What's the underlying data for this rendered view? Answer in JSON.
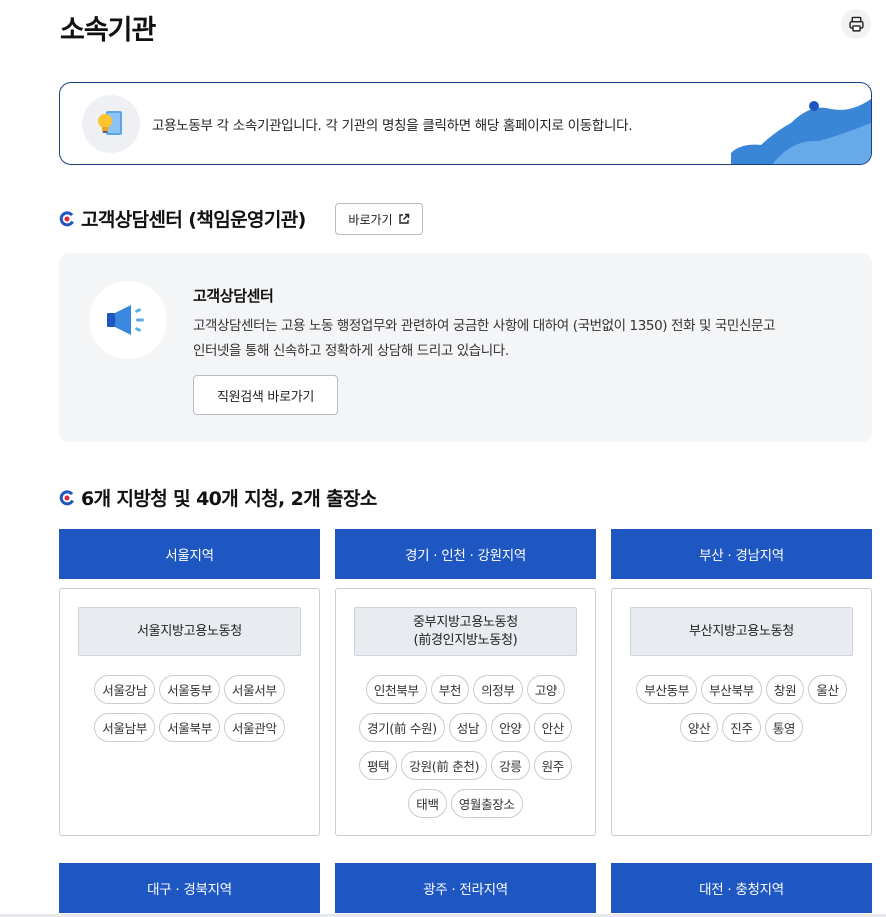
{
  "page": {
    "title": "소속기관"
  },
  "info": {
    "text": "고용노동부 각 소속기관입니다. 각 기관의 명칭을 클릭하면 해당 홈페이지로 이동합니다."
  },
  "callcenter": {
    "section_title": "고객상담센터 (책임운영기관)",
    "go_label": "바로가기",
    "name": "고객상담센터",
    "desc_line1": "고객상담센터는 고용 노동 행정업무와 관련하여 궁금한 사항에 대하여 (국번없이 1350) 전화 및 국민신문고",
    "desc_line2": "인터넷을 통해 신속하고 정확하게 상담해 드리고 있습니다.",
    "staff_search_label": "직원검색 바로가기"
  },
  "regions": {
    "section_title": "6개 지방청 및 40개 지청, 2개 출장소",
    "seoul": {
      "label": "서울지역",
      "office_line1": "서울지방고용노동청",
      "office_line2": "",
      "branches": [
        "서울강남",
        "서울동부",
        "서울서부",
        "서울남부",
        "서울북부",
        "서울관악"
      ]
    },
    "gyeonggi": {
      "label": "경기 · 인천 · 강원지역",
      "office_line1": "중부지방고용노동청",
      "office_line2": "(前경인지방노동청)",
      "branches": [
        "인천북부",
        "부천",
        "의정부",
        "고양",
        "경기(前 수원)",
        "성남",
        "안양",
        "안산",
        "평택",
        "강원(前 춘천)",
        "강릉",
        "원주",
        "태백",
        "영월출장소"
      ]
    },
    "busan": {
      "label": "부산 · 경남지역",
      "office_line1": "부산지방고용노동청",
      "office_line2": "",
      "branches": [
        "부산동부",
        "부산북부",
        "창원",
        "울산",
        "양산",
        "진주",
        "통영"
      ]
    },
    "daegu": {
      "label": "대구 · 경북지역"
    },
    "gwangju": {
      "label": "광주 · 전라지역"
    },
    "daejeon": {
      "label": "대전 · 충청지역"
    }
  },
  "colors": {
    "primary": "#1e56c2",
    "accent_red": "#e0263a",
    "banner_border": "#1b3f82"
  },
  "icons": [
    "print-icon",
    "lightbulb-book-icon",
    "megaphone-icon",
    "external-link-icon",
    "section-mark-icon"
  ]
}
